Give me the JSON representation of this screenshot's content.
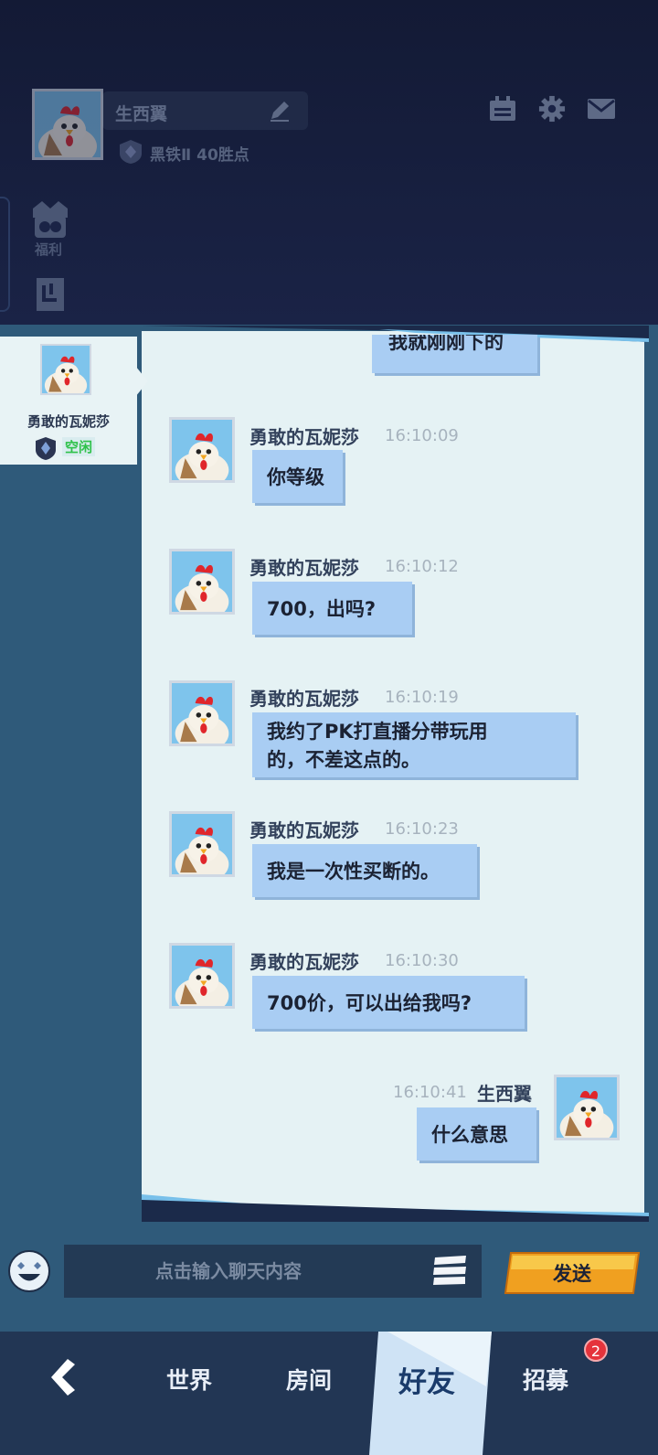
{
  "profile": {
    "name": "生西翼",
    "rank": "黑铁Ⅱ",
    "points": "40胜点"
  },
  "top_icons": [
    "clipboard-icon",
    "gear-icon",
    "mail-icon"
  ],
  "sidebar": {
    "welfare_label": "福利"
  },
  "friend": {
    "name": "勇敢的瓦妮莎",
    "status": "空闲"
  },
  "messages": [
    {
      "sender": "勇敢的瓦妮莎",
      "time": "16:10:09",
      "text": "你等级"
    },
    {
      "sender": "勇敢的瓦妮莎",
      "time": "16:10:12",
      "text": "700，出吗?"
    },
    {
      "sender": "勇敢的瓦妮莎",
      "time": "16:10:19",
      "text": "我约了PK打直播分带玩用",
      "text2": "的，不差这点的。"
    },
    {
      "sender": "勇敢的瓦妮莎",
      "time": "16:10:23",
      "text": "我是一次性买断的。"
    },
    {
      "sender": "勇敢的瓦妮莎",
      "time": "16:10:30",
      "text": "700价，可以出给我吗?"
    },
    {
      "sender": "生西翼",
      "time": "16:10:41",
      "text": "什么意思"
    }
  ],
  "partial_message": "我就刚刚下的",
  "input": {
    "placeholder": "点击输入聊天内容",
    "send_label": "发送"
  },
  "nav": {
    "tabs": [
      "世界",
      "房间",
      "好友",
      "招募"
    ],
    "active": "好友",
    "recruit_badge": "2"
  }
}
